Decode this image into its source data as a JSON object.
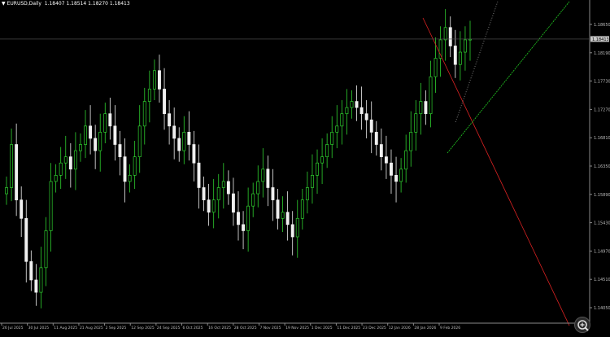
{
  "header": {
    "symbol": "EURUSD,Daily",
    "ohlc": "1.18407 1.18514 1.18270 1.18413"
  },
  "chart_data": {
    "type": "candlestick",
    "title": "EURUSD,Daily",
    "y_ticks": [
      "1.18650",
      "1.18190",
      "1.17730",
      "1.17270",
      "1.16810",
      "1.16350",
      "1.15890",
      "1.15430",
      "1.14970",
      "1.14510",
      "1.14050"
    ],
    "ylim": [
      1.1405,
      1.1865
    ],
    "bid_price_label": "1.18413",
    "x_ticks": [
      "26 Jul 2025",
      "30 Jul 2025",
      "11 Aug 2025",
      "21 Aug 2025",
      "2 Sep 2025",
      "12 Sep 2025",
      "24 Sep 2025",
      "6 Oct 2025",
      "16 Oct 2025",
      "28 Oct 2025",
      "7 Nov 2025",
      "19 Nov 2025",
      "1 Dec 2025",
      "11 Dec 2025",
      "23 Dec 2025",
      "12 Jan 2026",
      "28 Jan 2026",
      "9 Feb 2026"
    ],
    "candle_closes": [
      1.16,
      1.167,
      1.158,
      1.155,
      1.148,
      1.145,
      1.143,
      1.147,
      1.153,
      1.161,
      1.162,
      1.164,
      1.165,
      1.163,
      1.166,
      1.167,
      1.17,
      1.168,
      1.166,
      1.169,
      1.172,
      1.17,
      1.167,
      1.165,
      1.161,
      1.162,
      1.165,
      1.17,
      1.174,
      1.176,
      1.179,
      1.176,
      1.172,
      1.17,
      1.168,
      1.166,
      1.169,
      1.167,
      1.164,
      1.16,
      1.158,
      1.156,
      1.158,
      1.16,
      1.161,
      1.159,
      1.156,
      1.154,
      1.153,
      1.157,
      1.159,
      1.161,
      1.163,
      1.16,
      1.158,
      1.155,
      1.156,
      1.154,
      1.152,
      1.155,
      1.158,
      1.16,
      1.162,
      1.164,
      1.165,
      1.167,
      1.169,
      1.17,
      1.172,
      1.173,
      1.174,
      1.173,
      1.172,
      1.171,
      1.169,
      1.167,
      1.165,
      1.164,
      1.162,
      1.161,
      1.163,
      1.166,
      1.169,
      1.172,
      1.174,
      1.172,
      1.178,
      1.181,
      1.184,
      1.186,
      1.183,
      1.18,
      1.182,
      1.184,
      1.1841
    ]
  },
  "zoom": {
    "icon": "magnifier-plus"
  }
}
